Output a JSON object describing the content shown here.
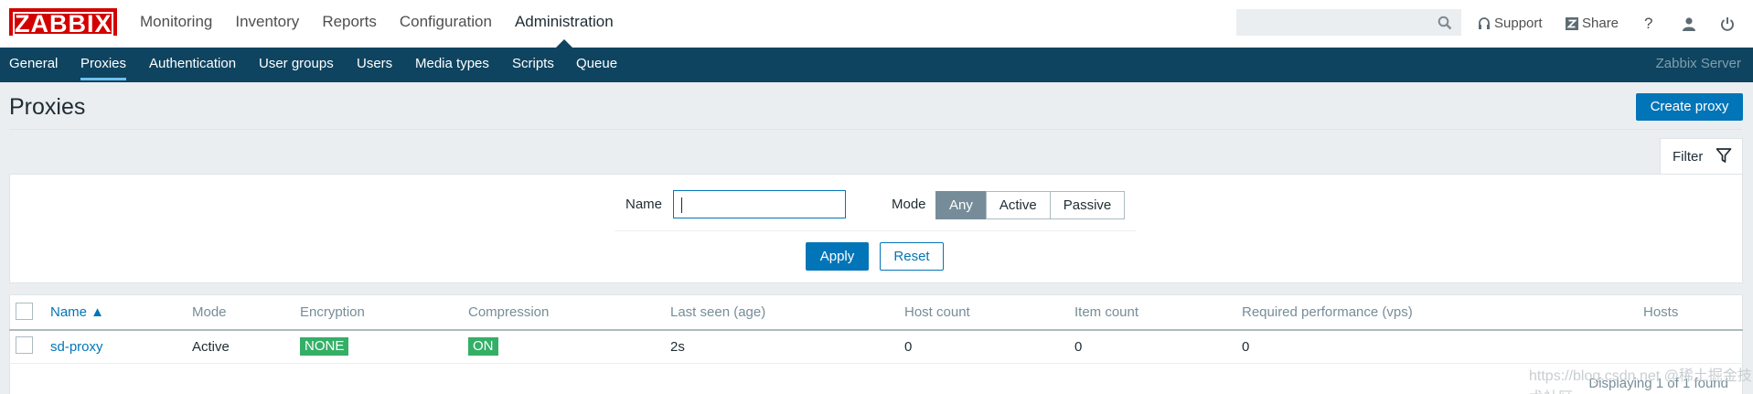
{
  "header": {
    "logo": "ZABBIX",
    "menu": [
      "Monitoring",
      "Inventory",
      "Reports",
      "Configuration",
      "Administration"
    ],
    "active_menu": "Administration",
    "search_placeholder": "",
    "support_label": "Support",
    "share_label": "Share",
    "help_label": "?"
  },
  "subnav": {
    "items": [
      "General",
      "Proxies",
      "Authentication",
      "User groups",
      "Users",
      "Media types",
      "Scripts",
      "Queue"
    ],
    "active": "Proxies",
    "server_name": "Zabbix Server"
  },
  "page": {
    "title": "Proxies",
    "create_button": "Create proxy"
  },
  "filter": {
    "tab_label": "Filter",
    "name_label": "Name",
    "name_value": "",
    "mode_label": "Mode",
    "mode_options": [
      "Any",
      "Active",
      "Passive"
    ],
    "mode_selected": "Any",
    "apply_label": "Apply",
    "reset_label": "Reset"
  },
  "table": {
    "columns": [
      "Name ▲",
      "Mode",
      "Encryption",
      "Compression",
      "Last seen (age)",
      "Host count",
      "Item count",
      "Required performance (vps)",
      "Hosts"
    ],
    "rows": [
      {
        "name": "sd-proxy",
        "mode": "Active",
        "encryption": "NONE",
        "compression": "ON",
        "last_seen": "2s",
        "host_count": "0",
        "item_count": "0",
        "required_performance": "0",
        "hosts": ""
      }
    ],
    "footer": "Displaying 1 of 1 found"
  },
  "watermark": "https://blog.csdn.net  @稀土掘金技术社区",
  "colors": {
    "brand_red": "#d40000",
    "nav_blue": "#0e4460",
    "accent_blue": "#0275b8",
    "badge_green": "#34af67",
    "segment_selected": "#768d99"
  }
}
